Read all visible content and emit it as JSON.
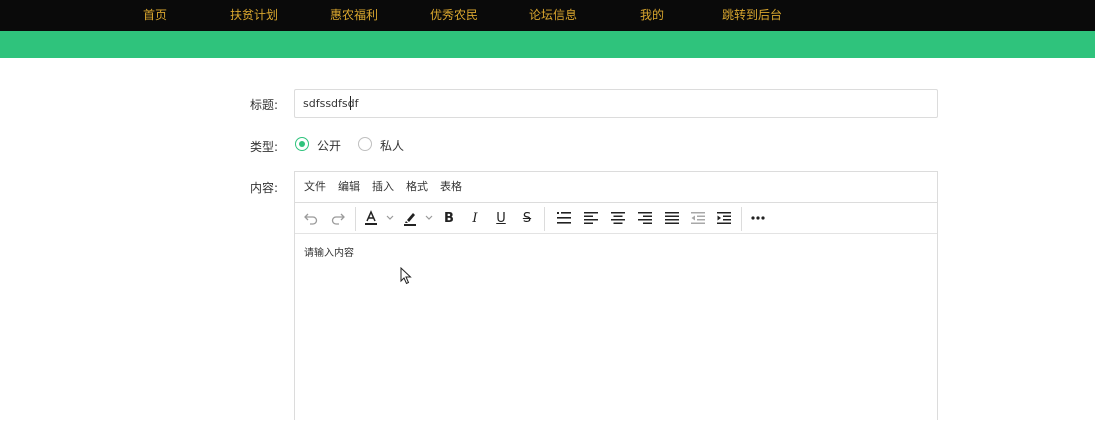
{
  "nav": {
    "items": [
      {
        "label": "首页"
      },
      {
        "label": "扶贫计划"
      },
      {
        "label": "惠农福利"
      },
      {
        "label": "优秀农民"
      },
      {
        "label": "论坛信息"
      },
      {
        "label": "我的"
      },
      {
        "label": "跳转到后台"
      }
    ]
  },
  "form": {
    "title_label": "标题:",
    "title_value": "sdfssdfsdf",
    "type_label": "类型:",
    "type_options": [
      {
        "label": "公开",
        "checked": true
      },
      {
        "label": "私人",
        "checked": false
      }
    ],
    "content_label": "内容:"
  },
  "editor": {
    "menu": [
      "文件",
      "编辑",
      "插入",
      "格式",
      "表格"
    ],
    "toolbar_icons": [
      "undo-icon",
      "redo-icon",
      "text-color-icon",
      "highlight-color-icon",
      "bold-icon",
      "italic-icon",
      "underline-icon",
      "strikethrough-icon",
      "bullet-list-icon",
      "align-left-icon",
      "align-center-icon",
      "align-right-icon",
      "align-justify-icon",
      "outdent-icon",
      "indent-icon",
      "more-icon"
    ],
    "bold_glyph": "B",
    "italic_glyph": "I",
    "underline_glyph": "U",
    "strike_glyph": "S",
    "placeholder": "请输入内容"
  },
  "colors": {
    "nav_bg": "#0a0a0a",
    "nav_text": "#d9a62e",
    "banner": "#2fc37c",
    "accent": "#2fc37c"
  }
}
